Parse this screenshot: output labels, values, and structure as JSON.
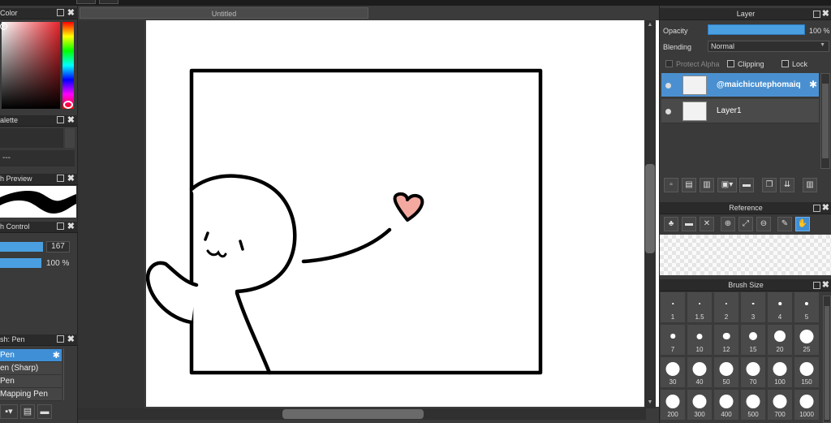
{
  "window": {
    "doc_title": "Untitled"
  },
  "left": {
    "color_panel": {
      "title": "Color"
    },
    "palette_panel": {
      "title": "alette",
      "value": "---"
    },
    "preview_panel": {
      "title": "h Preview"
    },
    "control_panel": {
      "title": "h Control",
      "size_value": "167",
      "opacity_value": "100 %"
    },
    "brush_panel": {
      "title": "sh: Pen",
      "items": [
        "Pen",
        "en (Sharp)",
        "Pen",
        "Mapping Pen"
      ]
    }
  },
  "layer_panel": {
    "title": "Layer",
    "opacity_label": "Opacity",
    "opacity_value": "100 %",
    "opacity": 1.0,
    "blending_label": "Blending",
    "blending_value": "Normal",
    "protect_alpha": "Protect Alpha",
    "clipping": "Clipping",
    "lock": "Lock",
    "layers": [
      {
        "name": "@maichicutephomaiq",
        "selected": true
      },
      {
        "name": "Layer1",
        "selected": false
      }
    ]
  },
  "reference_panel": {
    "title": "Reference"
  },
  "brush_size_panel": {
    "title": "Brush Size",
    "sizes": [
      "1",
      "1.5",
      "2",
      "3",
      "4",
      "5",
      "7",
      "10",
      "12",
      "15",
      "20",
      "25",
      "30",
      "40",
      "50",
      "70",
      "100",
      "150",
      "200",
      "300",
      "400",
      "500",
      "700",
      "1000"
    ]
  },
  "colors": {
    "accent": "#4a9fe0",
    "selection": "#3f8fd6",
    "heart": "#f4a9a0"
  }
}
